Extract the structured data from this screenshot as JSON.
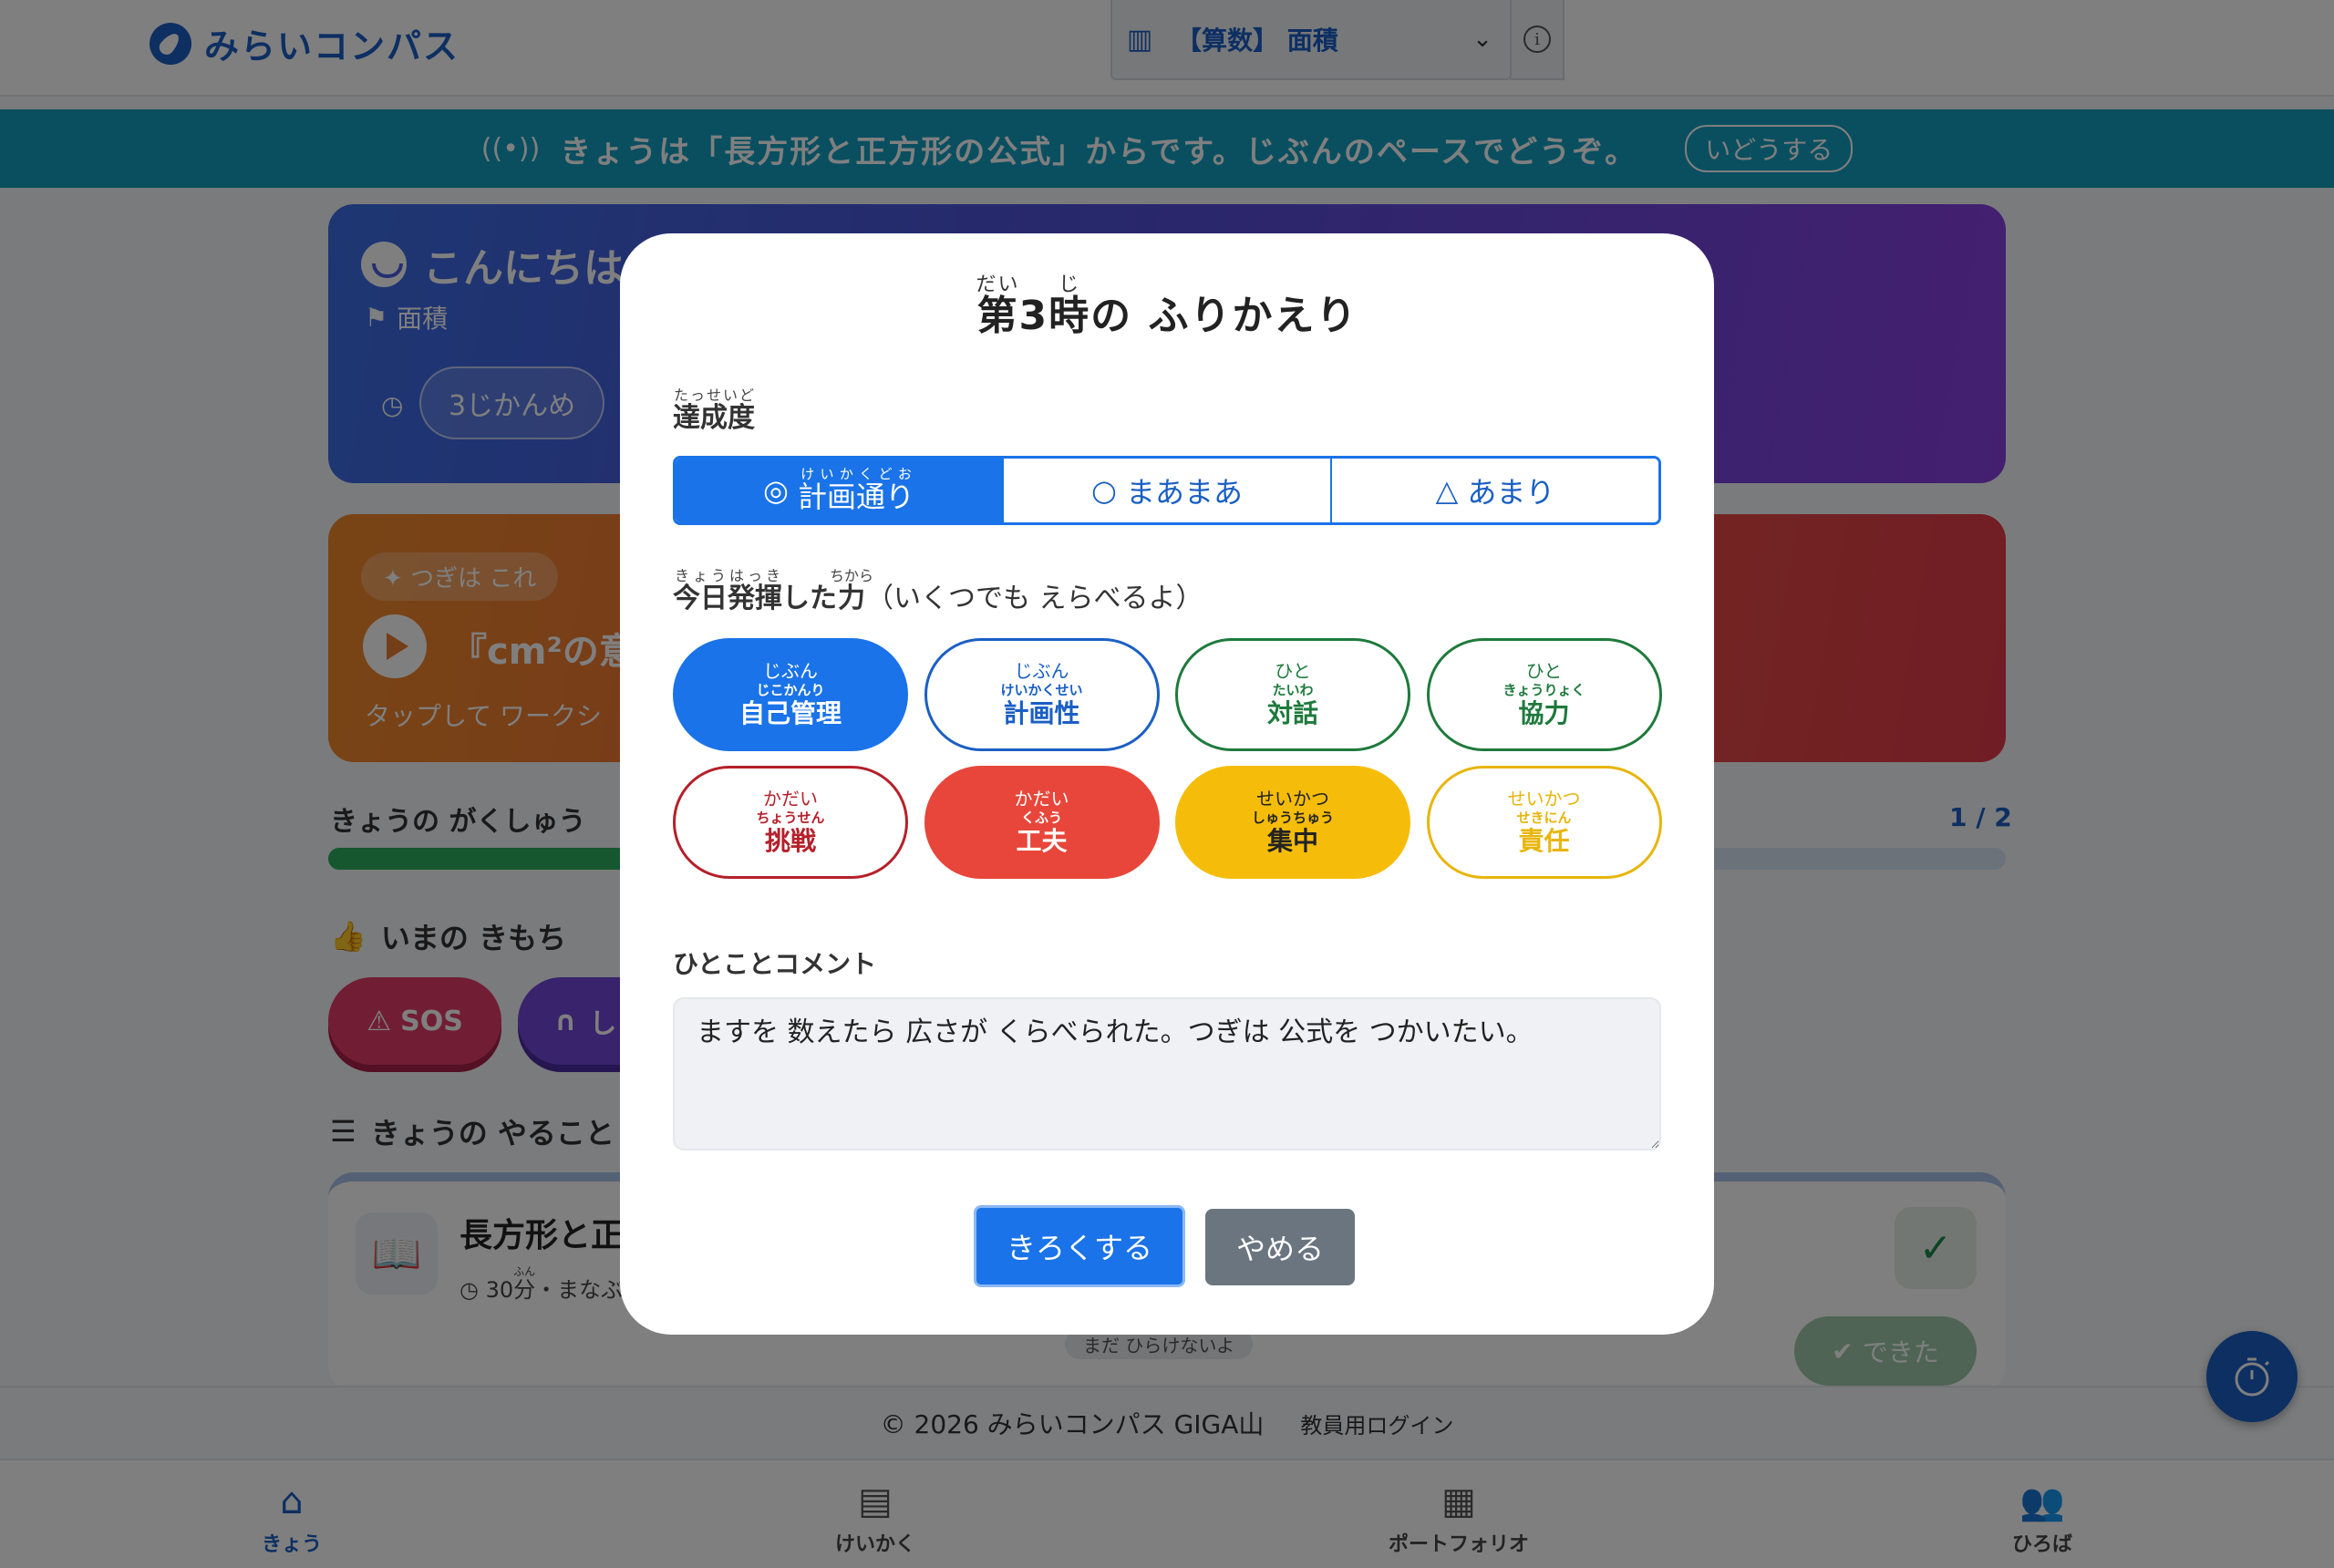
{
  "header": {
    "logo_text": "みらいコンパス",
    "subject_label": "【算数】 面積"
  },
  "banner": {
    "message": "きょうは「長方形と正方形の公式」からです。じぶんのペースでどうぞ。",
    "move_button": "いどうする"
  },
  "hello_card": {
    "title": "こんにちは",
    "topic": "面積",
    "period": "3じかんめ"
  },
  "next_card": {
    "tag": "つぎは これ",
    "title": "『cm²の意",
    "desc": "タップして ワークシ"
  },
  "learning": {
    "label": "きょうの がくしゅう",
    "count": "1 / 2",
    "progress": 0.5
  },
  "feelings": {
    "label": "いまの きもち",
    "sos": "SOS",
    "second": "し"
  },
  "todo": {
    "label": "きょうの やること",
    "title": "長方形と正",
    "minutes": "30",
    "minutes_unit": "分",
    "minutes_ruby": "ふん",
    "meta_rest": "・まなぶ",
    "note": "まだ ひらけないよ",
    "done_button": "できた"
  },
  "footer": {
    "copyright": "© 2026 みらいコンパス GIGA山",
    "teacher_login": "教員用ログイン"
  },
  "bottom_nav": {
    "today": "きょう",
    "plan": "けいかく",
    "portfolio": "ポートフォリオ",
    "plaza": "ひろば"
  },
  "modal": {
    "title_prefix": "第",
    "title_number": "3",
    "title_time": "時",
    "title_rest": "の ふりかえり",
    "title_ruby_dai": "だい",
    "title_ruby_ji": "じ",
    "achievement_label": "達成度",
    "achievement_ruby": "たっせいど",
    "achievement_options": [
      {
        "mark": "◎",
        "text": "計画通り",
        "ruby": "けいかくどお",
        "selected": true
      },
      {
        "mark": "○",
        "text": "まあまあ",
        "selected": false
      },
      {
        "mark": "△",
        "text": "あまり",
        "selected": false
      }
    ],
    "skills_label_1": "今日",
    "skills_ruby_1": "きょう",
    "skills_label_2": "発揮",
    "skills_ruby_2": "はっき",
    "skills_label_3": "した",
    "skills_label_4": "力",
    "skills_ruby_4": "ちから",
    "skills_label_5": "（いくつでも えらべるよ）",
    "skills": [
      {
        "category": "じぶん",
        "ruby": "じこかんり",
        "name": "自己管理",
        "color": "#1a73e8",
        "selected": true
      },
      {
        "category": "じぶん",
        "ruby": "けいかくせい",
        "name": "計画性",
        "color": "#1a5fc4",
        "selected": false
      },
      {
        "category": "ひと",
        "ruby": "たいわ",
        "name": "対話",
        "color": "#1e7a3c",
        "selected": false
      },
      {
        "category": "ひと",
        "ruby": "きょうりょく",
        "name": "協力",
        "color": "#1e7a3c",
        "selected": false
      },
      {
        "category": "かだい",
        "ruby": "ちょうせん",
        "name": "挑戦",
        "color": "#b5202a",
        "selected": false
      },
      {
        "category": "かだい",
        "ruby": "くふう",
        "name": "工夫",
        "color": "#e8463a",
        "selected": true
      },
      {
        "category": "せいかつ",
        "ruby": "しゅうちゅう",
        "name": "集中",
        "color": "#f5bd0a",
        "selected": true
      },
      {
        "category": "せいかつ",
        "ruby": "せきにん",
        "name": "責任",
        "color": "#e8b50a",
        "selected": false
      }
    ],
    "comment_label": "ひとことコメント",
    "comment_value": "ますを 数えたら 広さが くらべられた。つぎは 公式を つかいたい。",
    "save_button": "きろくする",
    "cancel_button": "やめる"
  }
}
